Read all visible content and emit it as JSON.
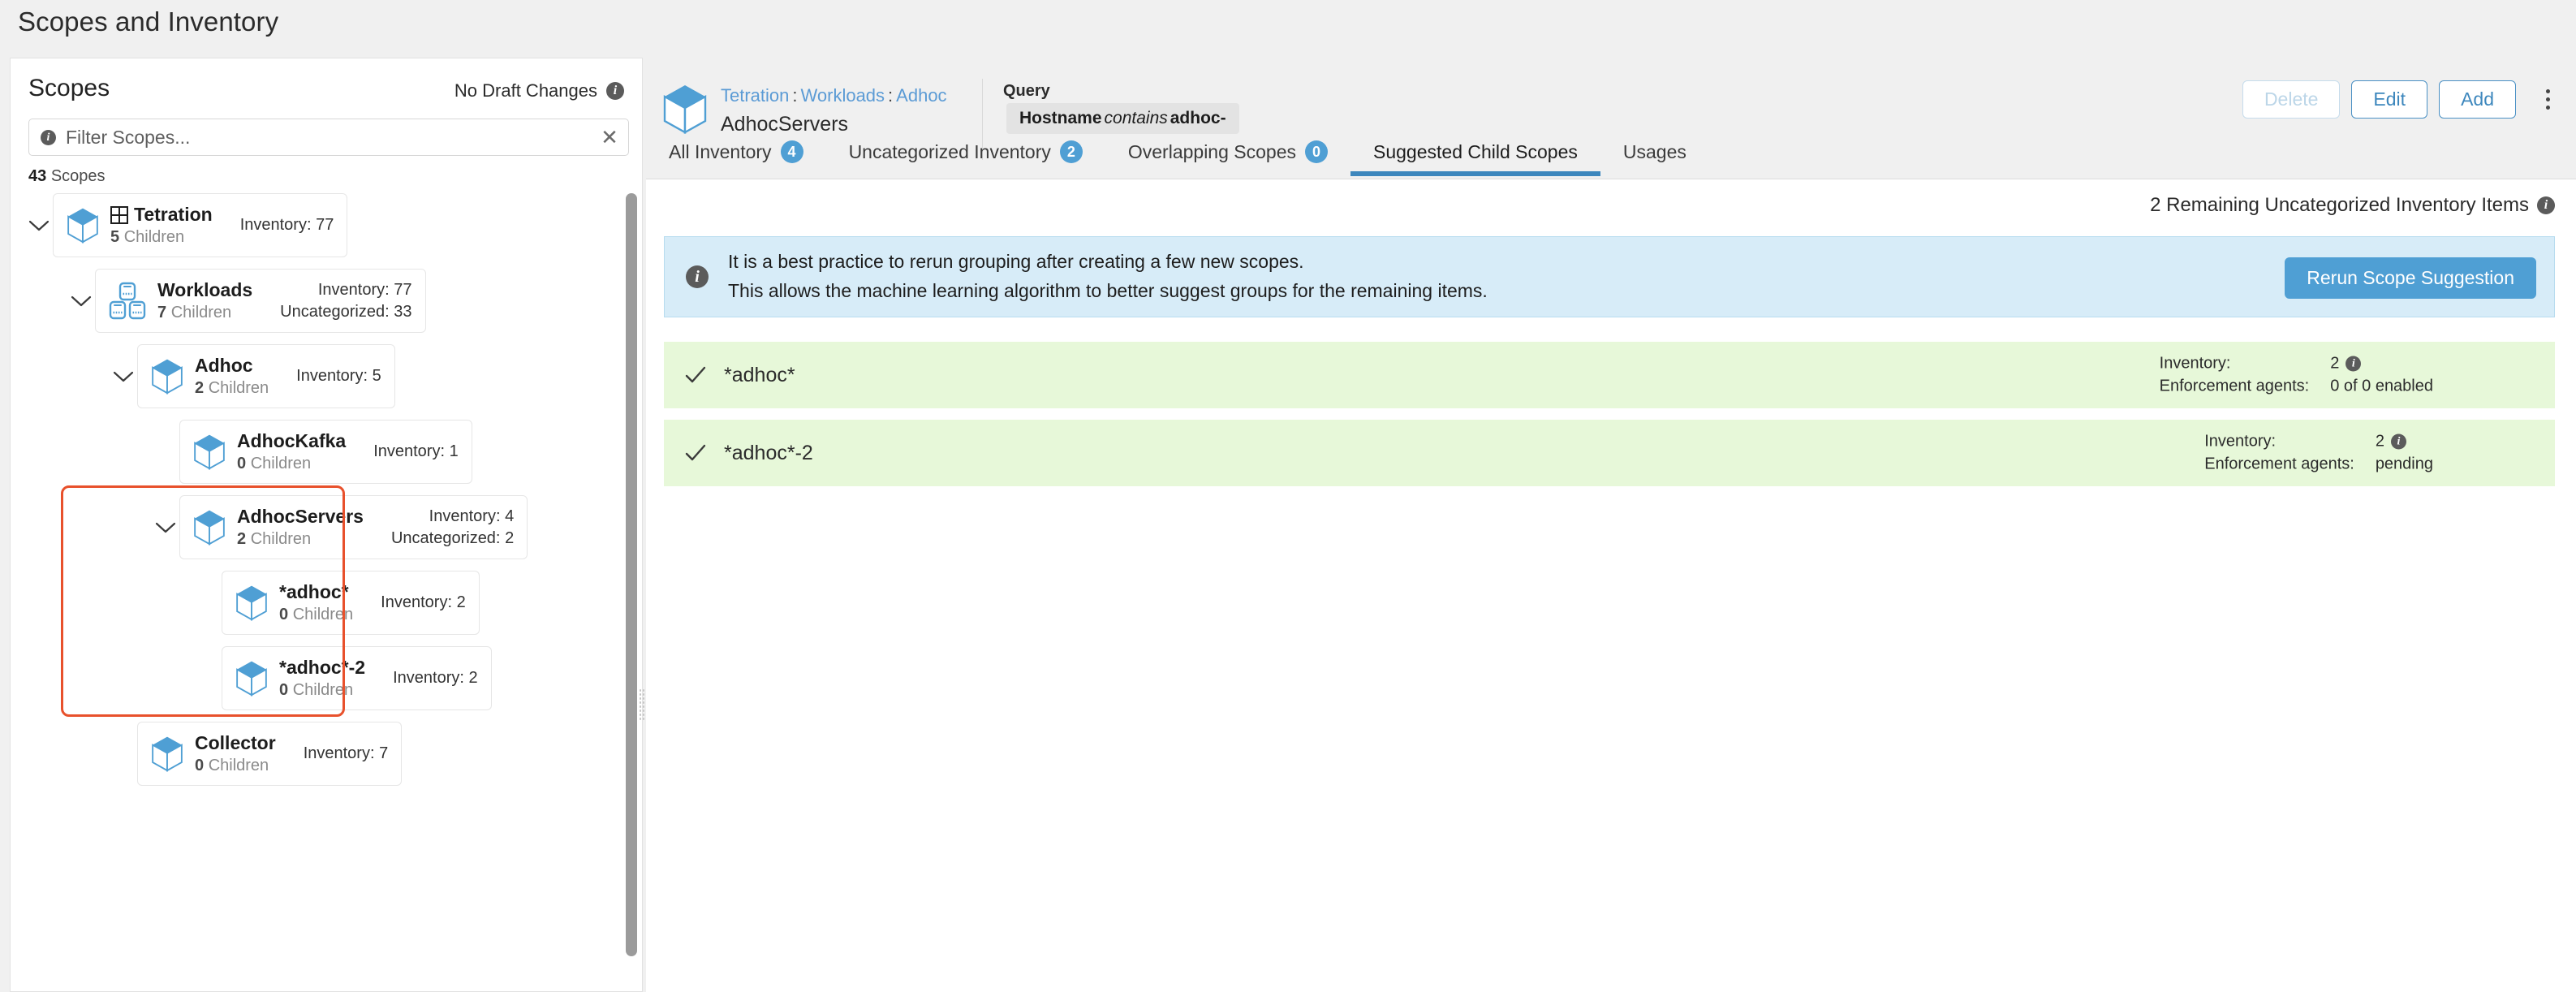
{
  "page": {
    "title": "Scopes and Inventory"
  },
  "sidebar": {
    "title": "Scopes",
    "draft_status": "No Draft Changes",
    "filter": {
      "placeholder": "Filter Scopes...",
      "value": "",
      "clear_icon": "close-icon"
    },
    "count_number": "43",
    "count_label": "Scopes",
    "tree": [
      {
        "name": "Tetration",
        "children": "5",
        "children_label": "Children",
        "inventory_label": "Inventory:",
        "inventory": "77",
        "uncategorized_label": "",
        "uncategorized": "",
        "icon": "scope-cube-icon",
        "prefix_icon": "grid-icon",
        "indent": 0,
        "expanded": true,
        "has_caret": true
      },
      {
        "name": "Workloads",
        "children": "7",
        "children_label": "Children",
        "inventory_label": "Inventory:",
        "inventory": "77",
        "uncategorized_label": "Uncategorized:",
        "uncategorized": "33",
        "icon": "workloads-boxes-icon",
        "prefix_icon": "",
        "indent": 1,
        "expanded": true,
        "has_caret": true
      },
      {
        "name": "Adhoc",
        "children": "2",
        "children_label": "Children",
        "inventory_label": "Inventory:",
        "inventory": "5",
        "uncategorized_label": "",
        "uncategorized": "",
        "icon": "scope-cube-icon",
        "prefix_icon": "",
        "indent": 2,
        "expanded": true,
        "has_caret": true
      },
      {
        "name": "AdhocKafka",
        "children": "0",
        "children_label": "Children",
        "inventory_label": "Inventory:",
        "inventory": "1",
        "uncategorized_label": "",
        "uncategorized": "",
        "icon": "scope-cube-icon",
        "prefix_icon": "",
        "indent": 3,
        "expanded": false,
        "has_caret": false
      },
      {
        "name": "AdhocServers",
        "children": "2",
        "children_label": "Children",
        "inventory_label": "Inventory:",
        "inventory": "4",
        "uncategorized_label": "Uncategorized:",
        "uncategorized": "2",
        "icon": "scope-cube-icon",
        "prefix_icon": "",
        "indent": 3,
        "expanded": true,
        "has_caret": true
      },
      {
        "name": "*adhoc*",
        "children": "0",
        "children_label": "Children",
        "inventory_label": "Inventory:",
        "inventory": "2",
        "uncategorized_label": "",
        "uncategorized": "",
        "icon": "scope-cube-icon",
        "prefix_icon": "",
        "indent": 4,
        "expanded": false,
        "has_caret": false
      },
      {
        "name": "*adhoc*-2",
        "children": "0",
        "children_label": "Children",
        "inventory_label": "Inventory:",
        "inventory": "2",
        "uncategorized_label": "",
        "uncategorized": "",
        "icon": "scope-cube-icon",
        "prefix_icon": "",
        "indent": 4,
        "expanded": false,
        "has_caret": false
      },
      {
        "name": "Collector",
        "children": "0",
        "children_label": "Children",
        "inventory_label": "Inventory:",
        "inventory": "7",
        "uncategorized_label": "",
        "uncategorized": "",
        "icon": "scope-cube-icon",
        "prefix_icon": "",
        "indent": 2,
        "expanded": false,
        "has_caret": false
      }
    ],
    "highlight_color": "#e8512c"
  },
  "main": {
    "breadcrumb": [
      "Tetration",
      "Workloads",
      "Adhoc"
    ],
    "breadcrumb_separator": ":",
    "scope_name": "AdhocServers",
    "query": {
      "label": "Query",
      "key": "Hostname",
      "operator": "contains",
      "value": "adhoc-"
    },
    "actions": {
      "delete": "Delete",
      "edit": "Edit",
      "add": "Add",
      "more": "kebab-menu-icon"
    },
    "tabs": [
      {
        "label": "All Inventory",
        "badge": "4",
        "active": false
      },
      {
        "label": "Uncategorized Inventory",
        "badge": "2",
        "active": false
      },
      {
        "label": "Overlapping Scopes",
        "badge": "0",
        "active": false
      },
      {
        "label": "Suggested Child Scopes",
        "badge": "",
        "active": true
      },
      {
        "label": "Usages",
        "badge": "",
        "active": false
      }
    ],
    "remaining_items": "2 Remaining Uncategorized Inventory Items",
    "notice": {
      "line1": "It is a best practice to rerun grouping after creating a few new scopes.",
      "line2": "This allows the machine learning algorithm to better suggest groups for the remaining items.",
      "button": "Rerun Scope Suggestion"
    },
    "suggestions": [
      {
        "name": "*adhoc*",
        "inventory_label": "Inventory:",
        "inventory": "2",
        "enforcement_label": "Enforcement agents:",
        "enforcement": "0 of 0 enabled"
      },
      {
        "name": "*adhoc*-2",
        "inventory_label": "Inventory:",
        "inventory": "2",
        "enforcement_label": "Enforcement agents:",
        "enforcement": "pending"
      }
    ]
  },
  "colors": {
    "accent": "#4f9fd4",
    "link": "#5b9bd5",
    "notice_bg": "#d7ecf8",
    "suggestion_bg": "#e7f8d9",
    "highlight": "#e8512c"
  }
}
